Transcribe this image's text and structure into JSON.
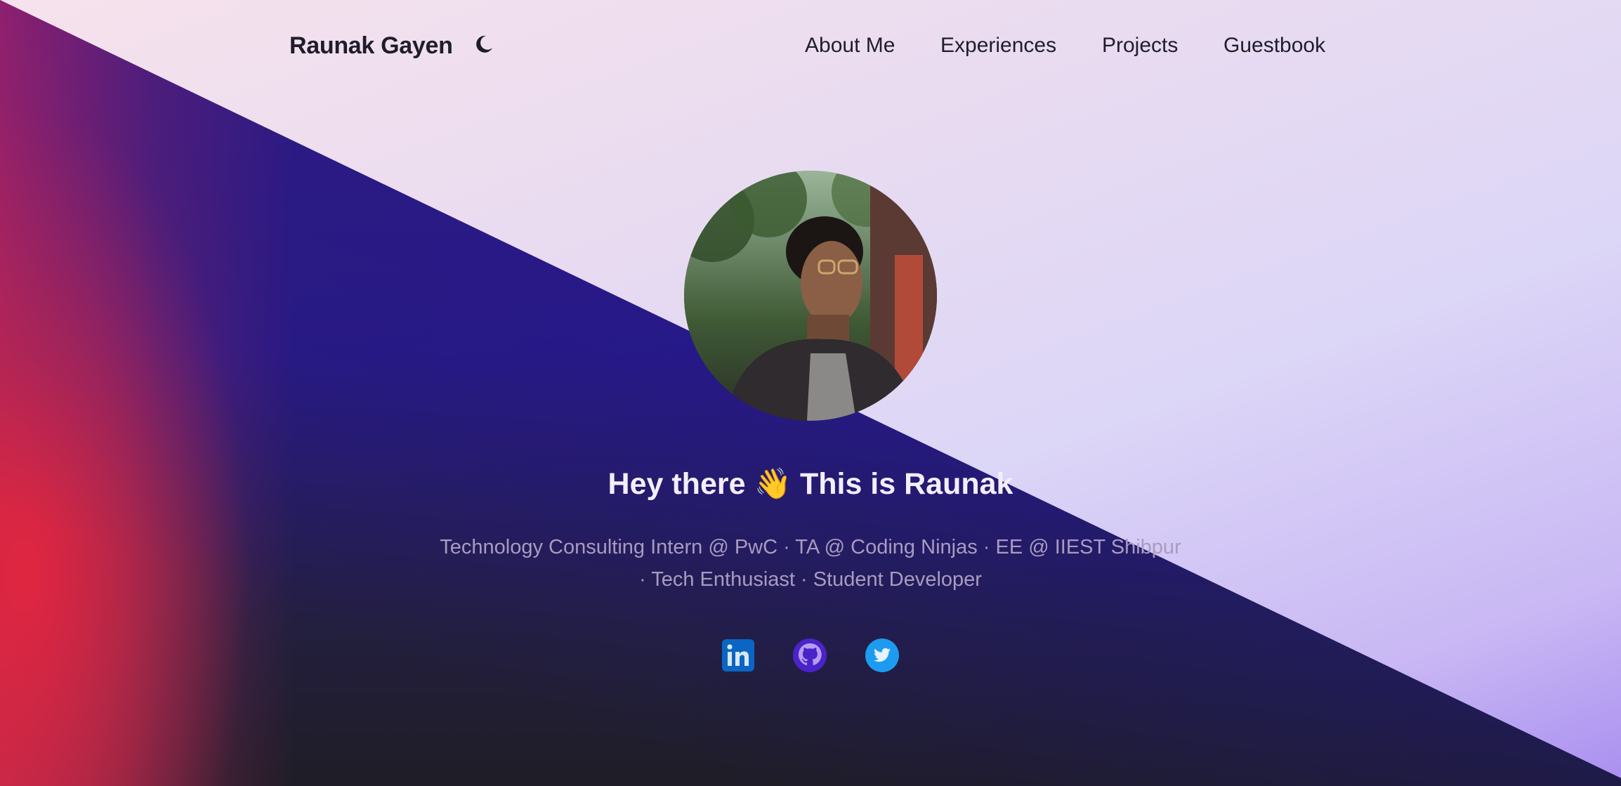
{
  "header": {
    "brand": "Raunak Gayen",
    "theme_toggle_icon": "moon-icon",
    "nav": [
      {
        "label": "About Me"
      },
      {
        "label": "Experiences"
      },
      {
        "label": "Projects"
      },
      {
        "label": "Guestbook"
      }
    ]
  },
  "hero": {
    "avatar_alt": "profile-photo",
    "greeting_emoji": "👋",
    "greeting_pre": "Hey there",
    "greeting_post": "This is Raunak",
    "subtitle_line1": "Technology Consulting Intern @ PwC · TA @ Coding Ninjas · EE @ IIEST Shibpur",
    "subtitle_line2": "· Tech Enthusiast · Student Developer"
  },
  "social": [
    {
      "icon": "linkedin-icon",
      "color": "#0a66c2"
    },
    {
      "icon": "github-icon",
      "color": "#6e45d8"
    },
    {
      "icon": "twitter-icon",
      "color": "#1d9bf0"
    }
  ]
}
